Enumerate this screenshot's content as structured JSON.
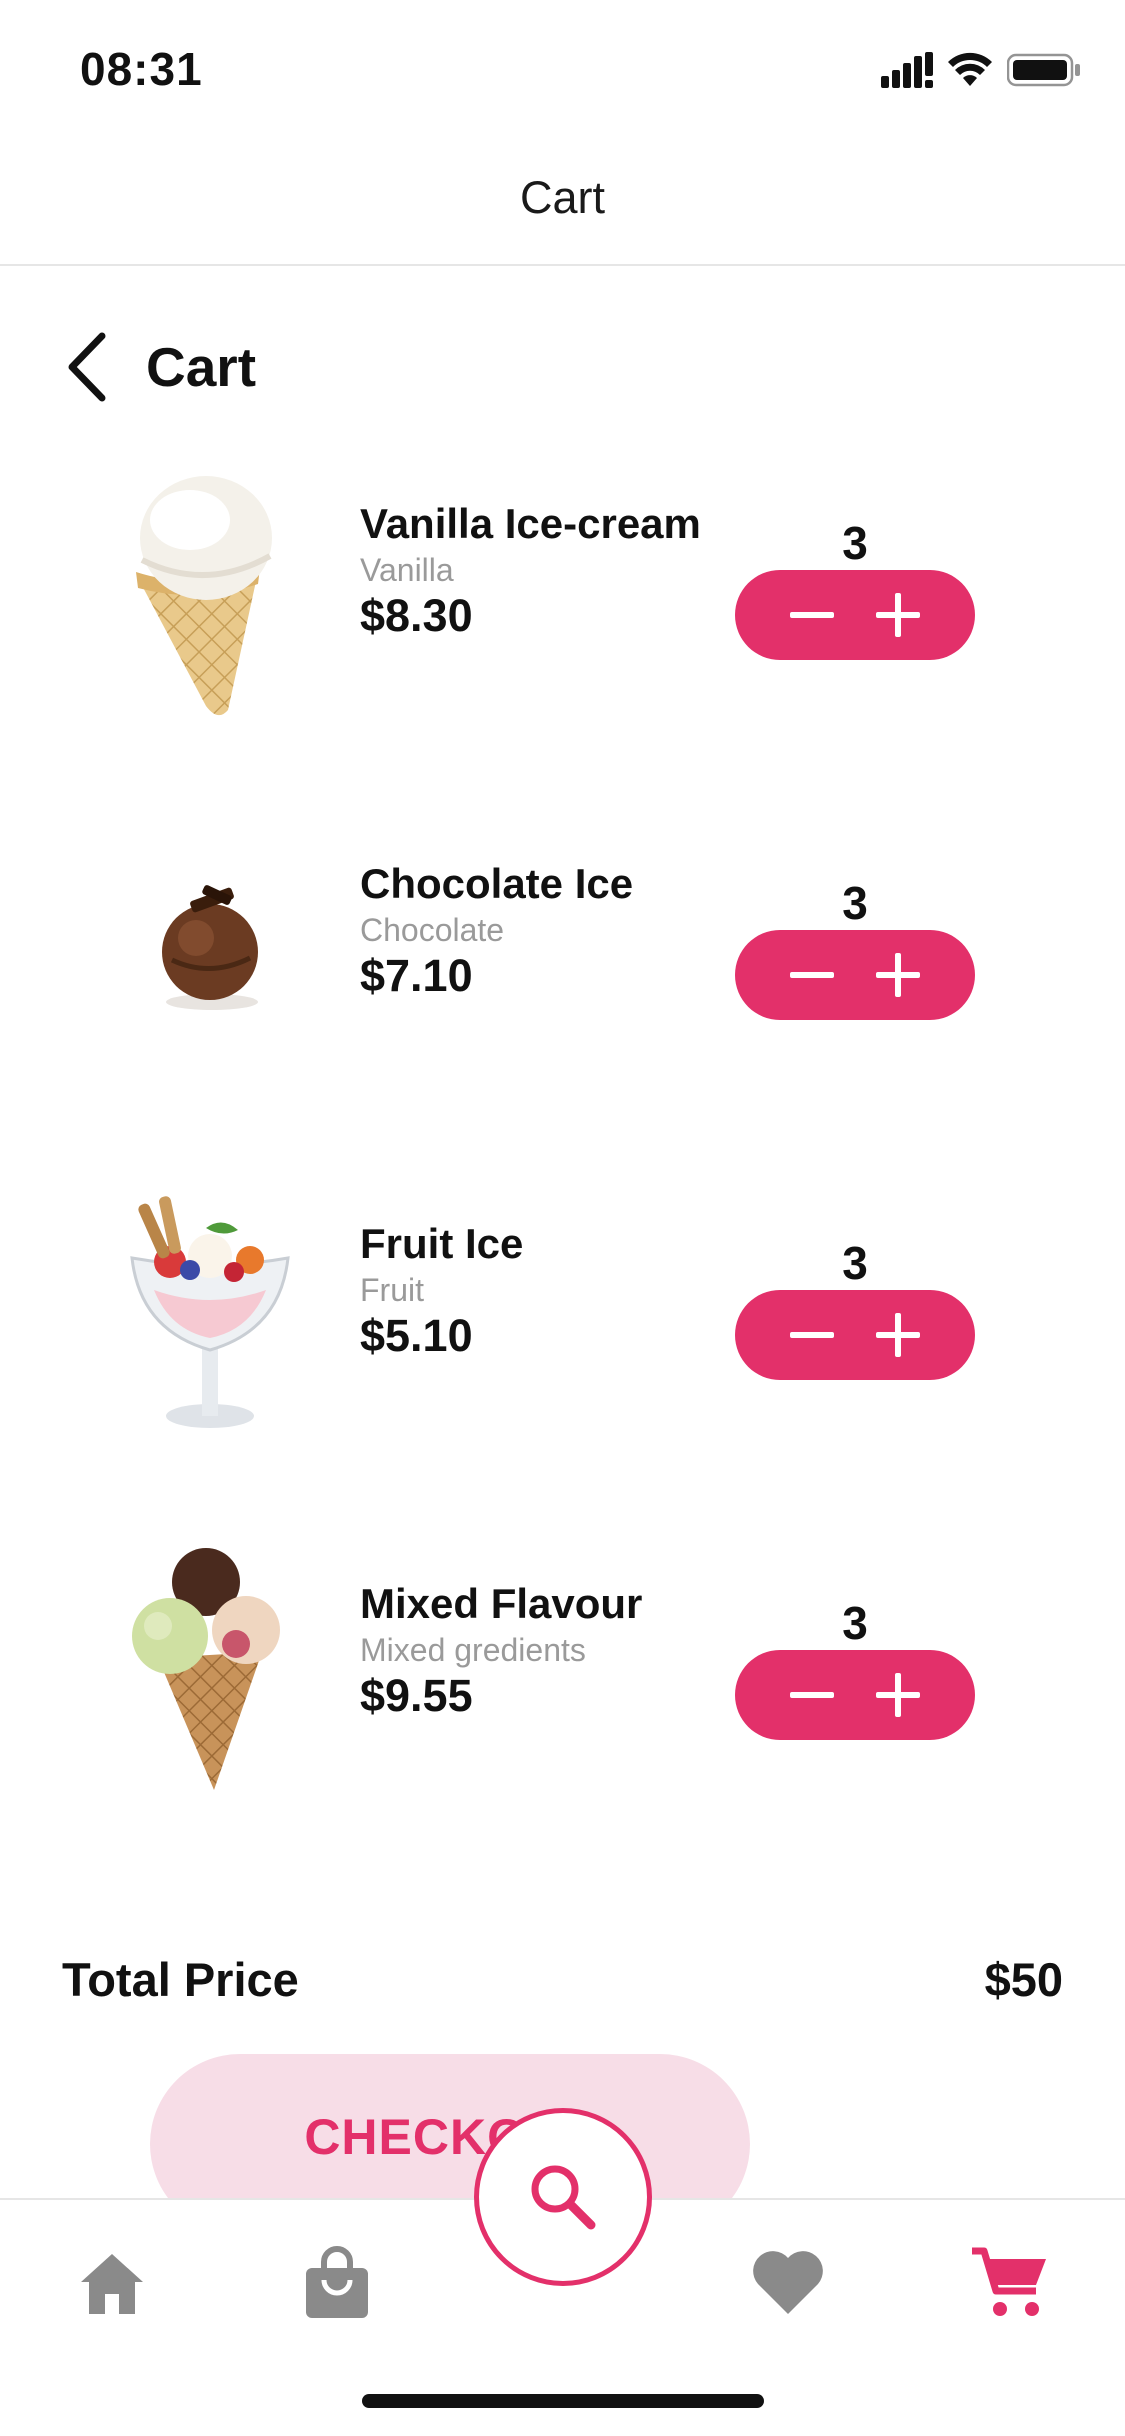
{
  "status_bar": {
    "time": "08:31",
    "icons": [
      "signal-icon",
      "wifi-icon",
      "battery-icon"
    ]
  },
  "nav_bar": {
    "title": "Cart"
  },
  "header": {
    "title": "Cart",
    "back_icon": "chevron-left-icon"
  },
  "items": [
    {
      "name": "Vanilla Ice-cream",
      "flavor": "Vanilla",
      "price": "$8.30",
      "quantity": "3",
      "image": "vanilla-cone"
    },
    {
      "name": "Chocolate Ice",
      "flavor": "Chocolate",
      "price": "$7.10",
      "quantity": "3",
      "image": "chocolate-scoop"
    },
    {
      "name": "Fruit Ice",
      "flavor": "Fruit",
      "price": "$5.10",
      "quantity": "3",
      "image": "fruit-sundae"
    },
    {
      "name": "Mixed Flavour",
      "flavor": "Mixed gredients",
      "price": "$9.55",
      "quantity": "3",
      "image": "mixed-cone"
    }
  ],
  "total": {
    "label": "Total Price",
    "value": "$50"
  },
  "checkout": {
    "label": "CHECKOUT"
  },
  "tabs": [
    {
      "icon": "home-icon",
      "active": false
    },
    {
      "icon": "shopping-bag-icon",
      "active": false
    },
    {
      "icon": "search-icon",
      "active": false
    },
    {
      "icon": "heart-icon",
      "active": false
    },
    {
      "icon": "cart-icon",
      "active": true
    }
  ],
  "colors": {
    "accent": "#e3306a",
    "accent_light": "#f7dde7",
    "inactive_icon": "#8a8a8a",
    "text": "#111111",
    "muted": "#9a9a9a"
  }
}
